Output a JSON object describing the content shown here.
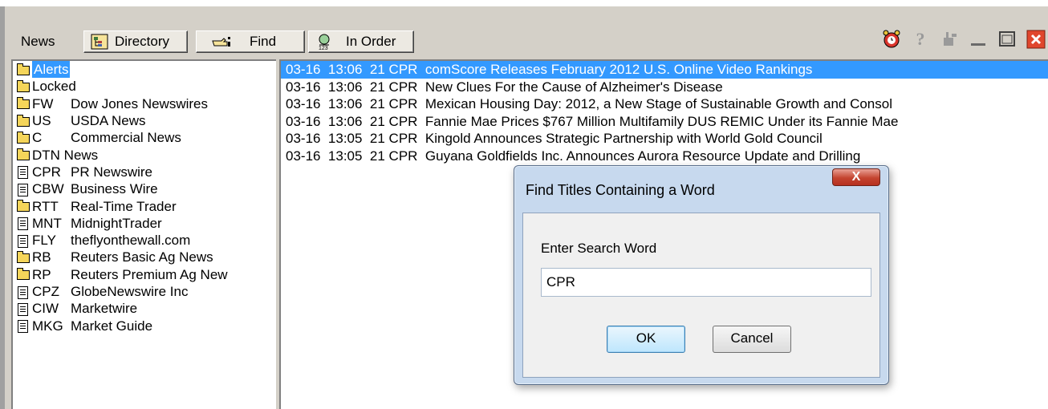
{
  "toolbar": {
    "news_label": "News",
    "directory_label": "Directory",
    "find_label": "Find",
    "inorder_label": "In Order",
    "right_icons": [
      "alarm-clock-icon",
      "help-icon",
      "pin-icon",
      "minimize-icon",
      "maximize-icon",
      "close-icon"
    ]
  },
  "directory": [
    {
      "icon": "folder",
      "code": "Alerts",
      "name": "",
      "selected": true
    },
    {
      "icon": "folder",
      "code": "Locked",
      "name": ""
    },
    {
      "icon": "folder",
      "code": "FW",
      "name": "Dow Jones Newswires"
    },
    {
      "icon": "folder",
      "code": "US",
      "name": "USDA News"
    },
    {
      "icon": "folder",
      "code": "C",
      "name": "Commercial News"
    },
    {
      "icon": "folder",
      "code": "DTN News",
      "name": ""
    },
    {
      "icon": "doc",
      "code": "CPR",
      "name": "PR Newswire"
    },
    {
      "icon": "doc",
      "code": "CBW",
      "name": "Business Wire"
    },
    {
      "icon": "folder",
      "code": "RTT",
      "name": "Real-Time Trader"
    },
    {
      "icon": "doc",
      "code": "MNT",
      "name": "MidnightTrader"
    },
    {
      "icon": "doc",
      "code": "FLY",
      "name": "theflyonthewall.com"
    },
    {
      "icon": "folder",
      "code": "RB",
      "name": "Reuters Basic Ag News"
    },
    {
      "icon": "folder",
      "code": "RP",
      "name": "Reuters Premium Ag New"
    },
    {
      "icon": "doc",
      "code": "CPZ",
      "name": "GlobeNewswire Inc"
    },
    {
      "icon": "doc",
      "code": "CIW",
      "name": "Marketwire"
    },
    {
      "icon": "doc",
      "code": "MKG",
      "name": "Market Guide"
    }
  ],
  "news": [
    {
      "text": "03-16  13:06  21 CPR  comScore Releases February 2012 U.S. Online Video Rankings",
      "selected": true
    },
    {
      "text": "03-16  13:06  21 CPR  New Clues For the Cause of Alzheimer's Disease"
    },
    {
      "text": "03-16  13:06  21 CPR  Mexican Housing Day: 2012, a New Stage of Sustainable Growth and Consol"
    },
    {
      "text": "03-16  13:06  21 CPR  Fannie Mae Prices $767 Million Multifamily DUS REMIC Under its Fannie Mae"
    },
    {
      "text": "03-16  13:05  21 CPR  Kingold Announces Strategic Partnership with World Gold Council"
    },
    {
      "text": "03-16  13:05  21 CPR  Guyana Goldfields Inc. Announces Aurora Resource Update and Drilling"
    }
  ],
  "dialog": {
    "title": "Find Titles Containing a Word",
    "close_label": "X",
    "prompt": "Enter Search Word",
    "input_value": "CPR",
    "ok_label": "OK",
    "cancel_label": "Cancel"
  }
}
